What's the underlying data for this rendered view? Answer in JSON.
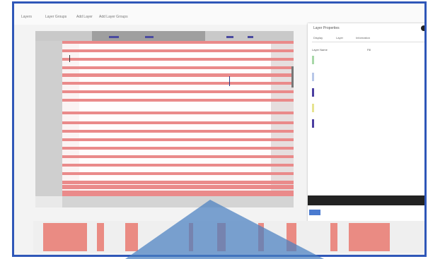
{
  "app": {
    "menu_items": [
      "Layers",
      "Layer Groups",
      "Add Layer",
      "Add Layer Groups"
    ]
  },
  "viewer": {
    "track_rows": 20,
    "x_ticks": [
      "",
      "",
      "",
      "",
      "",
      "",
      "",
      ""
    ]
  },
  "panel": {
    "title": "Layer Properties",
    "tabs": [
      "Display",
      "Layer",
      "Information"
    ],
    "rows": [
      {
        "label": "Layer Name",
        "value": "Fill",
        "color": "#ffffff",
        "options": ""
      },
      {
        "label": "",
        "value": "",
        "color": "#a7d8a8",
        "options": ""
      },
      {
        "label": "",
        "value": "",
        "color": "#b8c7e8",
        "options": ""
      },
      {
        "label": "",
        "value": "",
        "color": "#4b3fa0",
        "options": ""
      },
      {
        "label": "",
        "value": "",
        "color": "#e6e390",
        "options": ""
      },
      {
        "label": "",
        "value": "",
        "color": "#4b3fa0",
        "options": ""
      }
    ],
    "stats": [
      "",
      "",
      ""
    ]
  },
  "footer": {
    "left": "",
    "right_lines": [
      "",
      ""
    ]
  },
  "colors": {
    "frame_border": "#2f57b8",
    "row_red": "#ea8a8a",
    "overlay_blue": "#4a7fc1"
  }
}
